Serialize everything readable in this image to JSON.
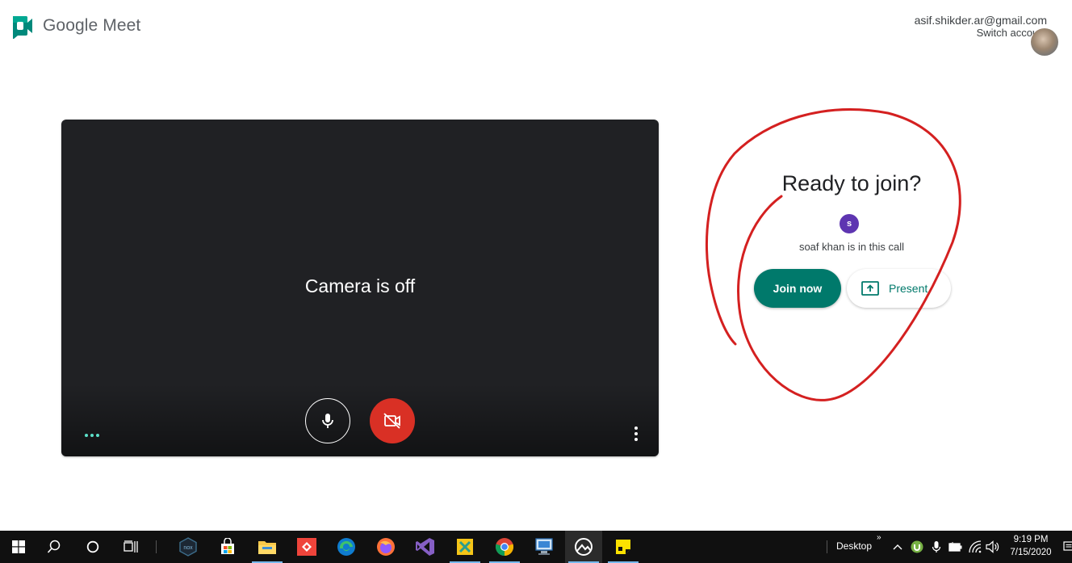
{
  "app": {
    "name": "Google Meet"
  },
  "account": {
    "email": "asif.shikder.ar@gmail.com",
    "switch_label": "Switch account"
  },
  "preview": {
    "status_text": "Camera is off"
  },
  "join": {
    "title": "Ready to join?",
    "participant_initial": "s",
    "participant_text": "soaf khan is in this call",
    "join_label": "Join now",
    "present_label": "Present"
  },
  "taskbar": {
    "desktop_label": "Desktop",
    "chevron": "»",
    "time": "9:19 PM",
    "date": "7/15/2020"
  },
  "colors": {
    "meet_green": "#00796b",
    "camera_off_red": "#d93025",
    "participant_purple": "#5e35b1",
    "annotation_red": "#d42020",
    "dark_preview": "#202124",
    "taskbar": "#101010"
  },
  "icons": [
    "google-meet-logo-icon",
    "mic-icon",
    "video-off-icon",
    "more-vert-icon",
    "present-screen-icon",
    "windows-start-icon",
    "search-icon",
    "cortana-icon",
    "task-view-icon",
    "nox-icon",
    "store-icon",
    "file-explorer-icon",
    "anydesk-icon",
    "edge-icon",
    "firefox-icon",
    "visual-studio-icon",
    "xampp-icon",
    "chrome-icon",
    "remote-desktop-icon",
    "photos-icon",
    "sticky-notes-icon",
    "utorrent-icon",
    "microphone-tray-icon",
    "battery-icon",
    "wifi-icon",
    "volume-icon",
    "notifications-icon"
  ]
}
